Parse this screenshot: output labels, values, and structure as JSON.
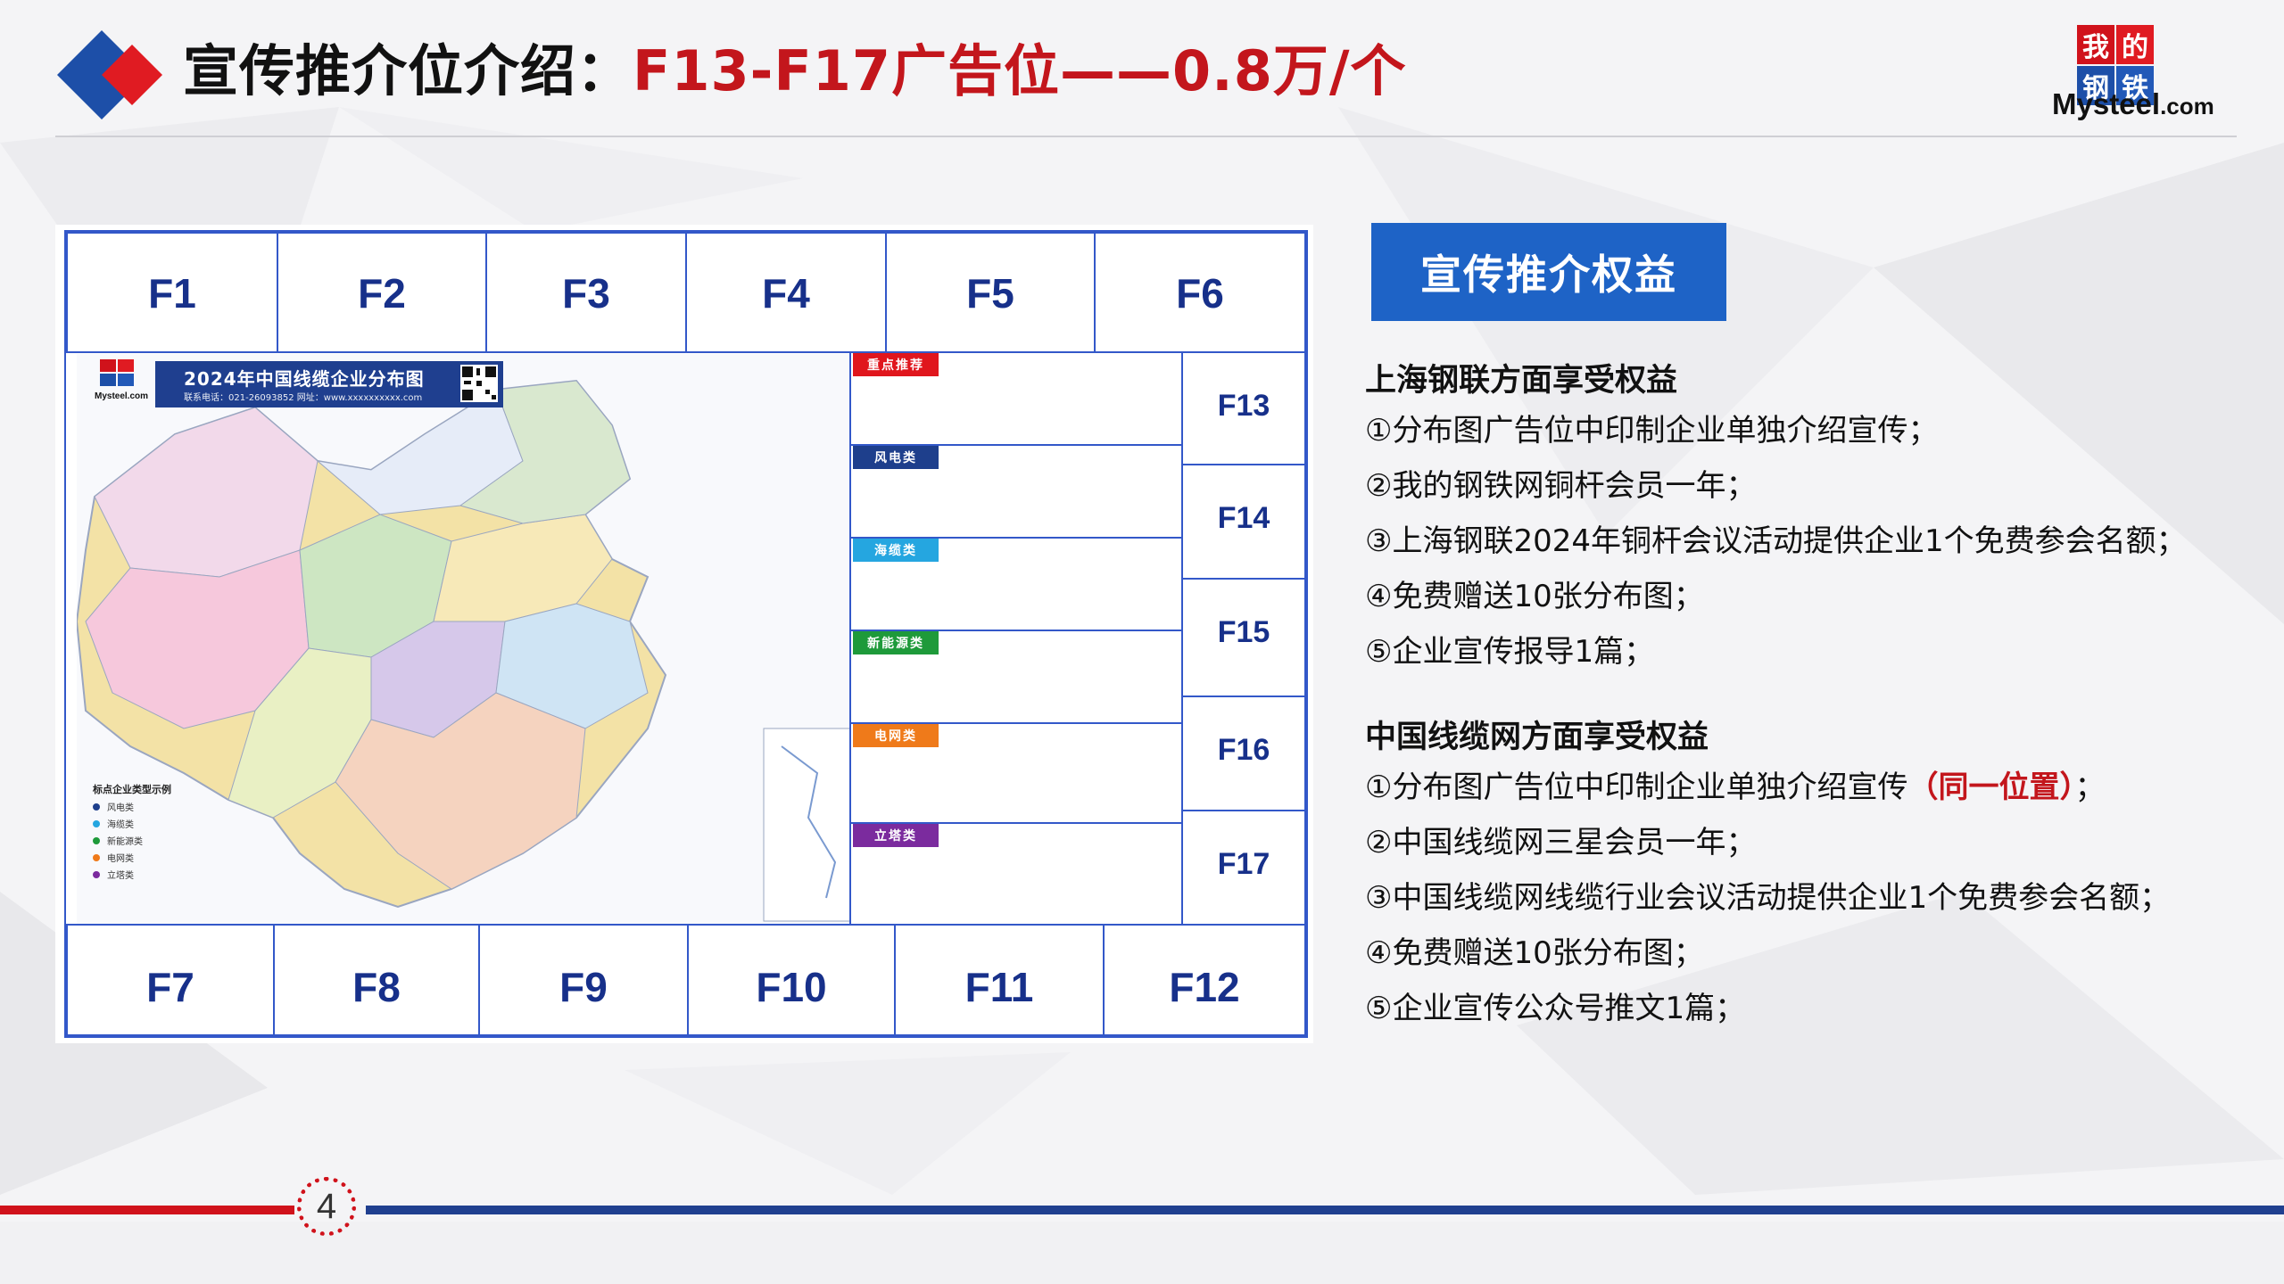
{
  "header": {
    "title_main": "宣传推介位介绍：",
    "title_accent": "F13-F17广告位——0.8万/个"
  },
  "logo": {
    "chars": [
      "我",
      "的",
      "钢",
      "铁"
    ],
    "brand": "Mysteel",
    "domain": ".com",
    "colors": [
      "#d0121b",
      "#1d4fa8"
    ]
  },
  "ad_grid": {
    "top_row": [
      "F1",
      "F2",
      "F3",
      "F4",
      "F5",
      "F6"
    ],
    "bottom_row": [
      "F7",
      "F8",
      "F9",
      "F10",
      "F11",
      "F12"
    ],
    "side_column": [
      "F13",
      "F14",
      "F15",
      "F16",
      "F17"
    ],
    "categories": [
      {
        "label": "重点推荐",
        "color": "#e0161d"
      },
      {
        "label": "风电类",
        "color": "#1e3f8c"
      },
      {
        "label": "海缆类",
        "color": "#25a6e0"
      },
      {
        "label": "新能源类",
        "color": "#1e9a3a"
      },
      {
        "label": "电网类",
        "color": "#ef7a1a"
      },
      {
        "label": "立塔类",
        "color": "#7b2b9e"
      }
    ],
    "map": {
      "title": "2024年中国线缆企业分布图",
      "contact": "联系电话：021-26093852 网址：www.xxxxxxxxxx.com",
      "logo_text": "Mysteel.com",
      "legend_title": "标点企业类型示例",
      "legend": [
        {
          "label": "风电类",
          "color": "#1e3f8c"
        },
        {
          "label": "海缆类",
          "color": "#25a6e0"
        },
        {
          "label": "新能源类",
          "color": "#1e9a3a"
        },
        {
          "label": "电网类",
          "color": "#ef7a1a"
        },
        {
          "label": "立塔类",
          "color": "#7b2b9e"
        }
      ]
    }
  },
  "benefits": {
    "badge": "宣传推介权益",
    "sections": [
      {
        "title": "上海钢联方面享受权益",
        "items": [
          "①分布图广告位中印制企业单独介绍宣传；",
          "②我的钢铁网铜杆会员一年；",
          "③上海钢联2024年铜杆会议活动提供企业1个免费参会名额；",
          "④免费赠送10张分布图；",
          "⑤企业宣传报导1篇；"
        ]
      },
      {
        "title": "中国线缆网方面享受权益",
        "items": [
          "①分布图广告位中印制企业单独介绍宣传",
          "②中国线缆网三星会员一年；",
          "③中国线缆网线缆行业会议活动提供企业1个免费参会名额；",
          "④免费赠送10张分布图；",
          "⑤企业宣传公众号推文1篇；"
        ],
        "item0_highlight": "（同一位置）",
        "item0_tail": "；"
      }
    ]
  },
  "footer": {
    "page": "4"
  },
  "colors": {
    "accent_red": "#c3161c",
    "brand_blue": "#1e63c6",
    "navy": "#1f3f8f"
  }
}
